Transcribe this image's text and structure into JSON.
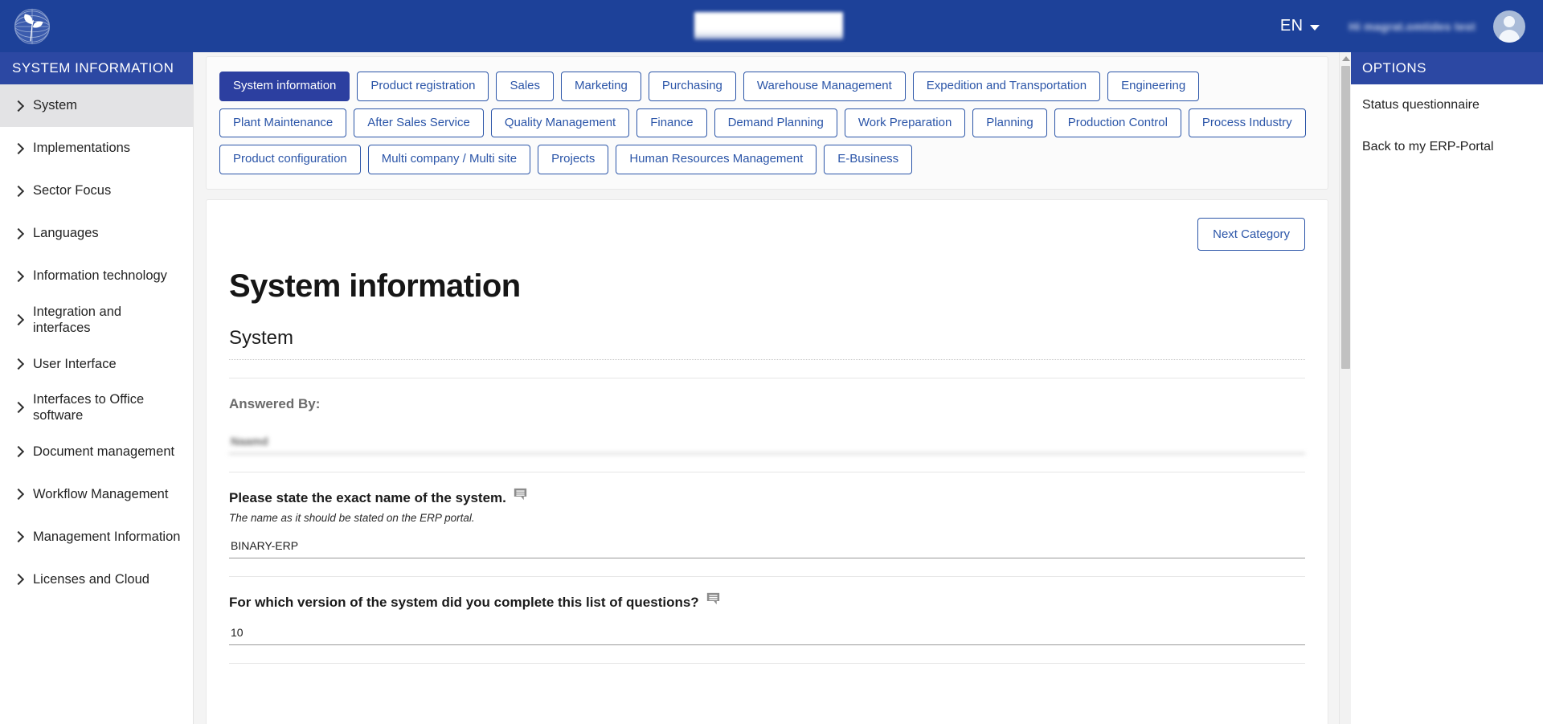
{
  "header": {
    "logo_alt": "globe-leaf-logo",
    "center_redacted": "",
    "language": "EN",
    "user_greeting": "Hi magrat.omtides test",
    "avatar_alt": "user-avatar"
  },
  "sidebar": {
    "title": "SYSTEM INFORMATION",
    "items": [
      {
        "label": "System",
        "active": true
      },
      {
        "label": "Implementations",
        "active": false
      },
      {
        "label": "Sector Focus",
        "active": false
      },
      {
        "label": "Languages",
        "active": false
      },
      {
        "label": "Information technology",
        "active": false
      },
      {
        "label": "Integration and interfaces",
        "active": false
      },
      {
        "label": "User Interface",
        "active": false
      },
      {
        "label": "Interfaces to Office software",
        "active": false
      },
      {
        "label": "Document management",
        "active": false
      },
      {
        "label": "Workflow Management",
        "active": false
      },
      {
        "label": "Management Information",
        "active": false
      },
      {
        "label": "Licenses and Cloud",
        "active": false
      }
    ]
  },
  "tabs": [
    {
      "label": "System information",
      "selected": true
    },
    {
      "label": "Product registration",
      "selected": false
    },
    {
      "label": "Sales",
      "selected": false
    },
    {
      "label": "Marketing",
      "selected": false
    },
    {
      "label": "Purchasing",
      "selected": false
    },
    {
      "label": "Warehouse Management",
      "selected": false
    },
    {
      "label": "Expedition and Transportation",
      "selected": false
    },
    {
      "label": "Engineering",
      "selected": false
    },
    {
      "label": "Plant Maintenance",
      "selected": false
    },
    {
      "label": "After Sales Service",
      "selected": false
    },
    {
      "label": "Quality Management",
      "selected": false
    },
    {
      "label": "Finance",
      "selected": false
    },
    {
      "label": "Demand Planning",
      "selected": false
    },
    {
      "label": "Work Preparation",
      "selected": false
    },
    {
      "label": "Planning",
      "selected": false
    },
    {
      "label": "Production Control",
      "selected": false
    },
    {
      "label": "Process Industry",
      "selected": false
    },
    {
      "label": "Product configuration",
      "selected": false
    },
    {
      "label": "Multi company / Multi site",
      "selected": false
    },
    {
      "label": "Projects",
      "selected": false
    },
    {
      "label": "Human Resources Management",
      "selected": false
    },
    {
      "label": "E-Business",
      "selected": false
    }
  ],
  "content": {
    "next_category_label": "Next Category",
    "page_title": "System information",
    "section_title": "System",
    "answered_by_label": "Answered By:",
    "answered_by_value": "Naamd",
    "questions": [
      {
        "text": "Please state the exact name of the system.",
        "hint": "The name as it should be stated on the ERP portal.",
        "value": "BINARY-ERP",
        "has_comment_icon": true
      },
      {
        "text": "For which version of the system did you complete this list of questions?",
        "hint": "",
        "value": "10",
        "has_comment_icon": true
      }
    ]
  },
  "options": {
    "title": "OPTIONS",
    "links": [
      {
        "label": "Status questionnaire"
      },
      {
        "label": "Back to my ERP-Portal"
      }
    ]
  },
  "colors": {
    "brand_blue": "#1d4199",
    "panel_header_blue": "#2c48a3",
    "tab_border_blue": "#2b55a8",
    "tab_selected_blue": "#2c3fa0",
    "page_bg": "#f4f4f4"
  }
}
